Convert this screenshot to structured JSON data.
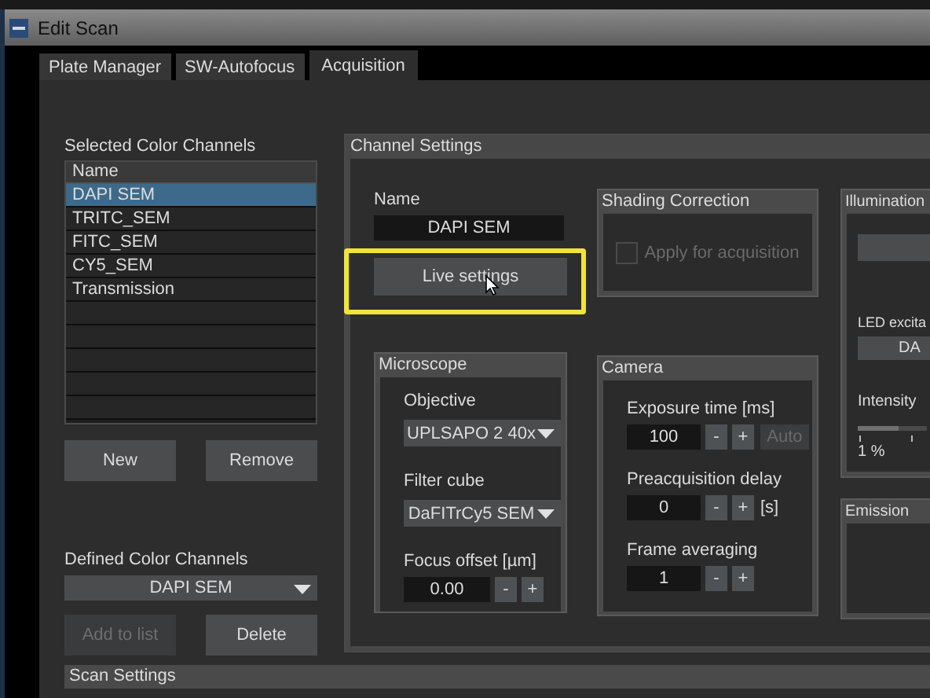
{
  "window": {
    "title": "Edit Scan"
  },
  "tabs": [
    {
      "label": "Plate Manager",
      "selected": false
    },
    {
      "label": "SW-Autofocus",
      "selected": false
    },
    {
      "label": "Acquisition",
      "selected": true
    }
  ],
  "selected_channels": {
    "title": "Selected Color Channels",
    "column": "Name",
    "rows": [
      {
        "label": "DAPI SEM",
        "selected": true
      },
      {
        "label": "TRITC_SEM",
        "selected": false
      },
      {
        "label": "FITC_SEM",
        "selected": false
      },
      {
        "label": "CY5_SEM",
        "selected": false
      },
      {
        "label": "Transmission",
        "selected": false
      }
    ]
  },
  "list_buttons": [
    {
      "label": "New",
      "disabled": false
    },
    {
      "label": "Remove",
      "disabled": false
    }
  ],
  "defined_channels": {
    "title": "Defined Color Channels",
    "value": "DAPI SEM"
  },
  "defined_buttons": [
    {
      "label": "Add to list",
      "disabled": true
    },
    {
      "label": "Delete",
      "disabled": false
    }
  ],
  "channel_settings": {
    "title": "Channel Settings",
    "name_label": "Name",
    "name_value": "DAPI SEM",
    "live_button": "Live settings",
    "highlighted": true
  },
  "shading": {
    "title": "Shading Correction",
    "checkbox": {
      "label": "Apply for acquisition",
      "checked": false,
      "disabled": true
    }
  },
  "illumination": {
    "title": "Illumination",
    "led_label": "LED excita",
    "led_value": "DA",
    "intensity_label": "Intensity",
    "intensity_min": "1 %",
    "level": 0.6
  },
  "microscope": {
    "title": "Microscope",
    "fields": [
      {
        "kind": "dropdown",
        "label": "Objective",
        "value": "UPLSAPO 2 40x"
      },
      {
        "kind": "dropdown",
        "label": "Filter cube",
        "value": "DaFITrCy5 SEM"
      },
      {
        "kind": "stepper",
        "label": "Focus offset [µm]",
        "value": "0.00",
        "minus": "-",
        "plus": "+"
      }
    ]
  },
  "camera": {
    "title": "Camera",
    "fields": [
      {
        "kind": "stepper",
        "label": "Exposure time [ms]",
        "value": "100",
        "minus": "-",
        "plus": "+",
        "button": {
          "label": "Auto",
          "disabled": true
        }
      },
      {
        "kind": "stepper",
        "label": "Preacquisition delay",
        "value": "0",
        "minus": "-",
        "plus": "+",
        "unit": "[s]"
      },
      {
        "kind": "stepper",
        "label": "Frame averaging",
        "value": "1",
        "minus": "-",
        "plus": "+"
      }
    ]
  },
  "emission": {
    "title": "Emission"
  },
  "scan_settings": {
    "title": "Scan Settings"
  }
}
